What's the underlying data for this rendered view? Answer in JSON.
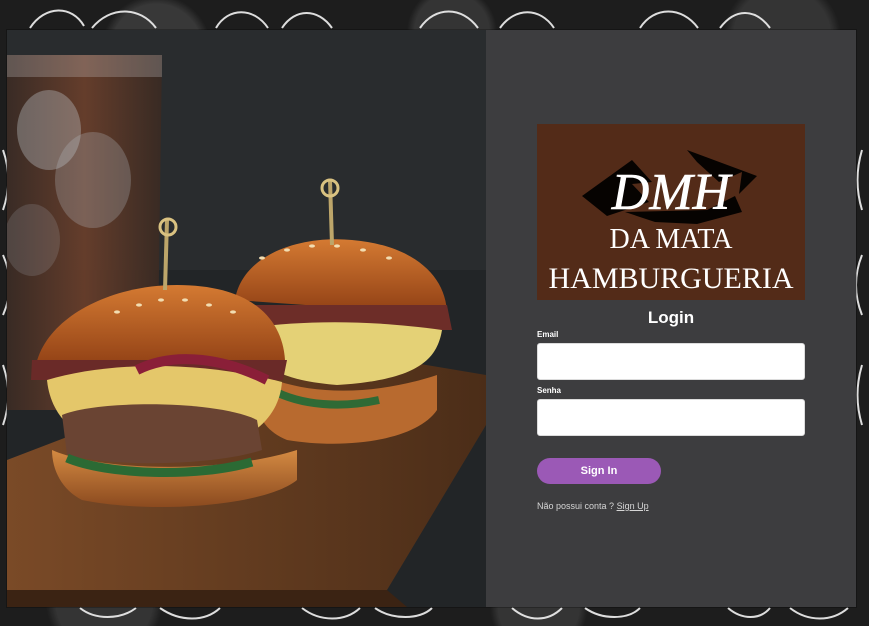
{
  "logo": {
    "monogram": "DMH",
    "line1": "DA MATA",
    "line2": "HAMBURGUERIA"
  },
  "form": {
    "title": "Login",
    "email_label": "Email",
    "email_value": "",
    "password_label": "Senha",
    "password_value": "",
    "submit_label": "Sign In",
    "signup_prompt": "Não possui conta ? ",
    "signup_link": "Sign Up"
  },
  "colors": {
    "page_background": "#1d1d1d",
    "panel_background": "#3d3d3f",
    "logo_background": "#532b18",
    "button": "#9b59b6"
  }
}
